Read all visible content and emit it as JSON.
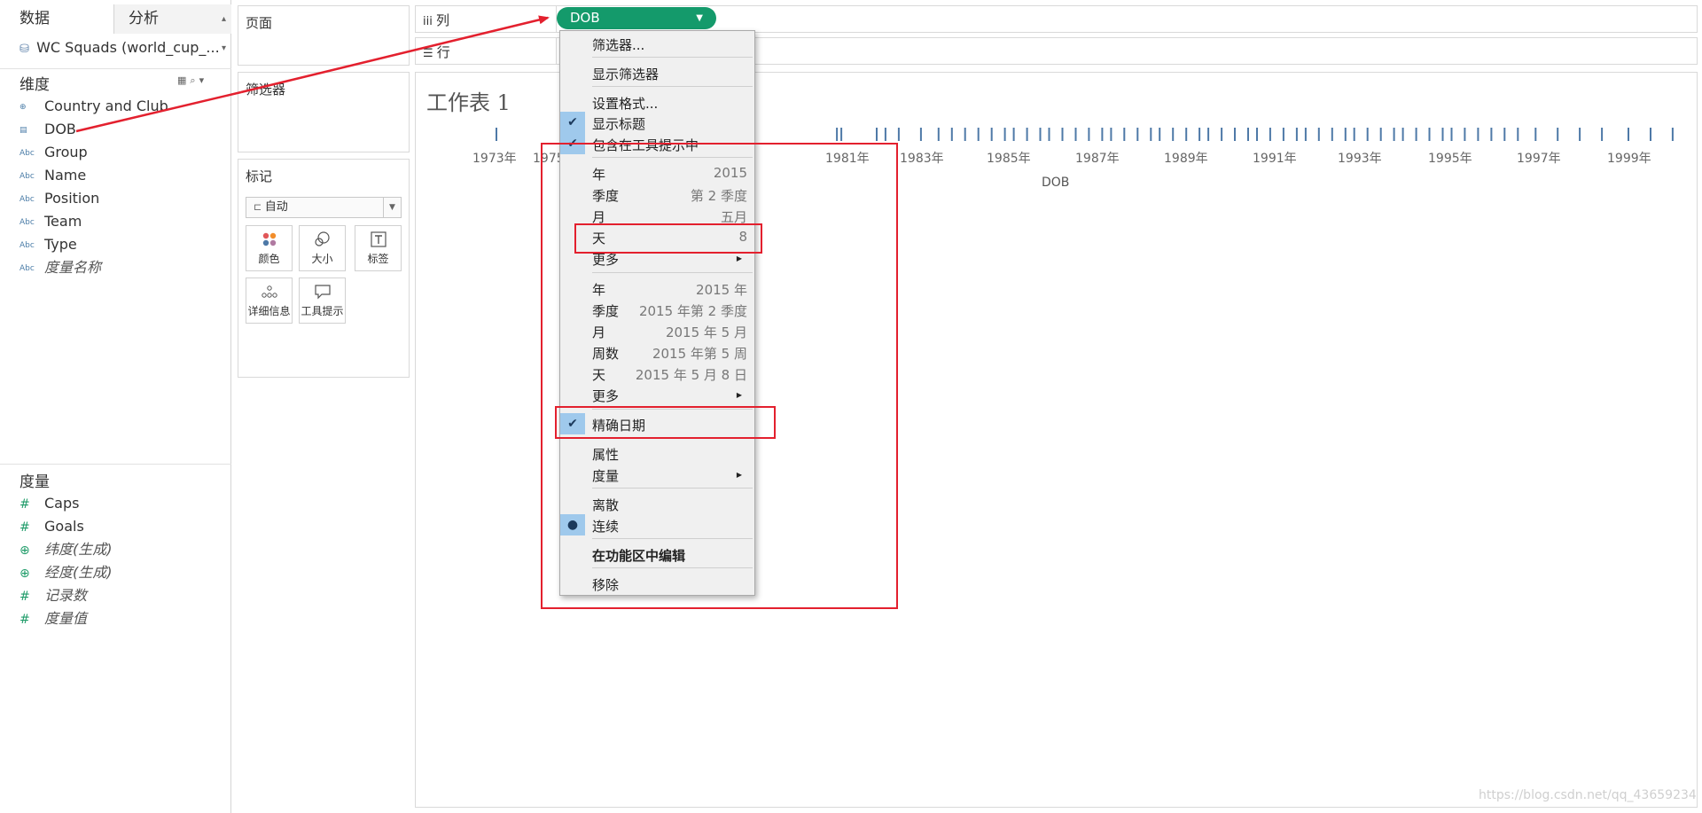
{
  "data_pane": {
    "tab_data": "数据",
    "tab_analysis": "分析",
    "datasource": "WC Squads (world_cup_...",
    "dimensions_title": "维度",
    "dimensions": [
      {
        "icon": "globe-icon",
        "label": "Country and Club",
        "italic": false
      },
      {
        "icon": "calendar-icon",
        "label": "DOB",
        "italic": false
      },
      {
        "icon": "abc-icon",
        "label": "Group",
        "italic": false
      },
      {
        "icon": "abc-icon",
        "label": "Name",
        "italic": false
      },
      {
        "icon": "abc-icon",
        "label": "Position",
        "italic": false
      },
      {
        "icon": "abc-icon",
        "label": "Team",
        "italic": false
      },
      {
        "icon": "abc-icon",
        "label": "Type",
        "italic": false
      },
      {
        "icon": "abc-icon",
        "label": "度量名称",
        "italic": true
      }
    ],
    "measures_title": "度量",
    "measures": [
      {
        "icon": "hash-icon",
        "label": "Caps",
        "italic": false
      },
      {
        "icon": "hash-icon",
        "label": "Goals",
        "italic": false
      },
      {
        "icon": "globe-icon",
        "label": "纬度(生成)",
        "italic": true
      },
      {
        "icon": "globe-icon",
        "label": "经度(生成)",
        "italic": true
      },
      {
        "icon": "hash-icon",
        "label": "记录数",
        "italic": true
      },
      {
        "icon": "hash-icon",
        "label": "度量值",
        "italic": true
      }
    ]
  },
  "cards": {
    "pages": "页面",
    "filters": "筛选器",
    "marks": "标记",
    "marks_type": "自动",
    "mark_buttons": [
      "颜色",
      "大小",
      "标签",
      "详细信息",
      "工具提示"
    ]
  },
  "shelves": {
    "columns_label": "列",
    "rows_label": "行",
    "pill": "DOB"
  },
  "view": {
    "sheet_title": "工作表 1"
  },
  "chart_data": {
    "type": "strip",
    "title": "",
    "xlabel": "DOB",
    "x_ticks": [
      "1973年",
      "1975年",
      "1981年",
      "1983年",
      "1985年",
      "1987年",
      "1989年",
      "1991年",
      "1993年",
      "1995年",
      "1997年",
      "1999年"
    ],
    "mark_color": "#4e79a7",
    "marks_dob_year": [
      1973.3,
      1981.0,
      1981.1,
      1981.9,
      1982.1,
      1982.4,
      1982.9,
      1983.3,
      1983.6,
      1983.9,
      1984.2,
      1984.5,
      1984.8,
      1985.0,
      1985.3,
      1985.6,
      1985.8,
      1986.1,
      1986.4,
      1986.7,
      1987.0,
      1987.2,
      1987.5,
      1987.8,
      1988.1,
      1988.3,
      1988.6,
      1988.9,
      1989.2,
      1989.4,
      1989.7,
      1990.0,
      1990.3,
      1990.5,
      1990.8,
      1991.1,
      1991.4,
      1991.6,
      1991.9,
      1992.2,
      1992.5,
      1992.7,
      1993.0,
      1993.3,
      1993.6,
      1993.8,
      1994.1,
      1994.4,
      1994.7,
      1994.9,
      1995.2,
      1995.5,
      1995.8,
      1996.1,
      1996.4,
      1996.8,
      1997.3,
      1997.8,
      1998.3,
      1998.9,
      1999.4,
      1999.9
    ]
  },
  "context_menu": {
    "filter": "筛选器...",
    "show_filter": "显示筛选器",
    "format": "设置格式...",
    "show_header": "显示标题",
    "include_tooltip": "包含在工具提示中",
    "year": "年",
    "year_val": "2015",
    "quarter": "季度",
    "quarter_val": "第 2 季度",
    "month": "月",
    "month_val": "五月",
    "day": "天",
    "day_val": "8",
    "more": "更多",
    "year2": "年",
    "year2_val": "2015 年",
    "quarter2": "季度",
    "quarter2_val": "2015 年第 2 季度",
    "month2": "月",
    "month2_val": "2015 年 5 月",
    "week2": "周数",
    "week2_val": "2015 年第 5 周",
    "day2": "天",
    "day2_val": "2015 年 5 月 8 日",
    "more2": "更多",
    "exact_date": "精确日期",
    "attribute": "属性",
    "measure": "度量",
    "discrete": "离散",
    "continuous": "连续",
    "edit_in_shelf": "在功能区中编辑",
    "remove": "移除"
  },
  "watermark": "https://blog.csdn.net/qq_43659234",
  "colors": {
    "pill": "#149a6b",
    "annotation": "#e3202e",
    "check_bg": "#9fc9ec"
  }
}
